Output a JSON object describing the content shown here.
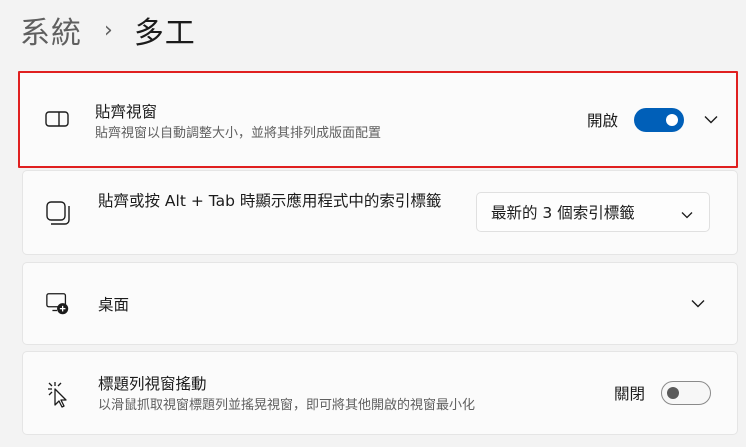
{
  "breadcrumb": {
    "parent": "系統",
    "separator": "›",
    "current": "多工"
  },
  "snap_windows": {
    "icon": "snap-layout-icon",
    "title": "貼齊視窗",
    "subtitle": "貼齊視窗以自動調整大小，並將其排列成版面配置",
    "toggle_label": "開啟",
    "toggle_on": true,
    "highlight_color": "#e02020"
  },
  "alt_tab": {
    "icon": "stacked-windows-icon",
    "title": "貼齊或按 Alt + Tab 時顯示應用程式中的索引標籤",
    "dropdown_value": "最新的 3 個索引標籤"
  },
  "desktops": {
    "icon": "add-desktop-icon",
    "title": "桌面"
  },
  "title_bar_shake": {
    "icon": "shake-cursor-icon",
    "title": "標題列視窗搖動",
    "subtitle": "以滑鼠抓取視窗標題列並搖晃視窗，即可將其他開啟的視窗最小化",
    "toggle_label": "關閉",
    "toggle_on": false
  },
  "colors": {
    "accent": "#005fb8",
    "background": "#f3f3f3",
    "card": "#fbfbfb"
  }
}
